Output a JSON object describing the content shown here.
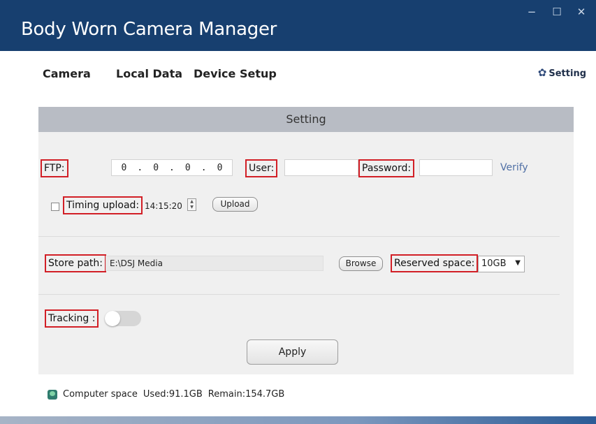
{
  "window": {
    "title": "Body Worn Camera Manager",
    "controls": {
      "minimize": "−",
      "maximize": "☐",
      "close": "✕"
    }
  },
  "nav": {
    "items": [
      {
        "label": "Camera"
      },
      {
        "label": "Local Data"
      },
      {
        "label": "Device Setup"
      }
    ],
    "setting": {
      "label": "Setting",
      "icon": "gear-icon"
    }
  },
  "panel": {
    "title": "Setting",
    "ftp": {
      "label": "FTP:",
      "ip": [
        "0",
        ".",
        "0",
        ".",
        "0",
        ".",
        "0"
      ],
      "user_label": "User:",
      "user_value": "",
      "password_label": "Password:",
      "password_value": "",
      "verify_label": "Verify"
    },
    "timing": {
      "checked": false,
      "label": "Timing upload:",
      "time": "14:15:20",
      "upload_label": "Upload"
    },
    "storage": {
      "store_label": "Store path:",
      "path": "E:\\DSJ Media",
      "browse_label": "Browse",
      "reserved_label": "Reserved space:",
      "reserved_value": "10GB"
    },
    "tracking": {
      "label": "Tracking :",
      "on": false
    },
    "apply_label": "Apply"
  },
  "status": {
    "label": "Computer space",
    "used": "Used:91.1GB",
    "remain": "Remain:154.7GB",
    "icon": "disk-icon"
  },
  "colors": {
    "titlebar": "#173f6f",
    "highlight": "#d21f26",
    "verify": "#4f6fa5",
    "panel": "#f0f0f0",
    "panel_header": "#b8bcc4"
  }
}
